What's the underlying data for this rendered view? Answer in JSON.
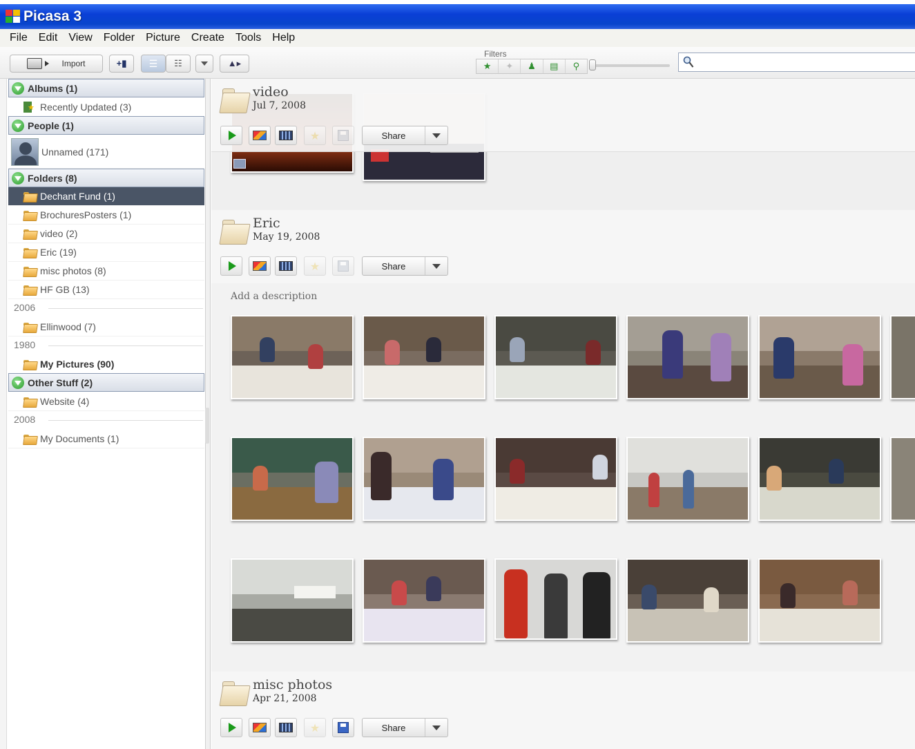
{
  "window": {
    "title": "Picasa 3"
  },
  "menu": [
    "File",
    "Edit",
    "View",
    "Folder",
    "Picture",
    "Create",
    "Tools",
    "Help"
  ],
  "toolbar": {
    "import_label": "Import",
    "filters_label": "Filters",
    "search_placeholder": ""
  },
  "sidebar": {
    "sections": [
      {
        "label": "Albums (1)"
      },
      {
        "label": "People (1)"
      },
      {
        "label": "Folders (8)"
      },
      {
        "label": "Other Stuff (2)"
      }
    ],
    "albums": [
      {
        "label": "Recently Updated (3)"
      }
    ],
    "people": [
      {
        "label": "Unnamed (171)"
      }
    ],
    "folders": [
      {
        "label": "Dechant Fund (1)"
      },
      {
        "label": "BrochuresPosters (1)"
      },
      {
        "label": "video (2)"
      },
      {
        "label": "Eric (19)"
      },
      {
        "label": "misc photos (8)"
      },
      {
        "label": "HF GB (13)"
      },
      {
        "label": "Ellinwood (7)"
      },
      {
        "label": "My Pictures (90)"
      }
    ],
    "years": [
      "2006",
      "1980",
      "2008"
    ],
    "other": [
      {
        "label": "Website (4)"
      },
      {
        "label": "My Documents (1)"
      }
    ]
  },
  "groups": [
    {
      "name": "video",
      "date": "Jul 7, 2008",
      "share": "Share"
    },
    {
      "name": "Eric",
      "date": "May 19, 2008",
      "share": "Share",
      "description": "Add a description"
    },
    {
      "name": "misc photos",
      "date": "Apr 21, 2008",
      "share": "Share"
    }
  ],
  "colors": {
    "titlebar": "#0a3fd6",
    "selection": "#4a5566",
    "section_border": "#8c9bb2"
  }
}
